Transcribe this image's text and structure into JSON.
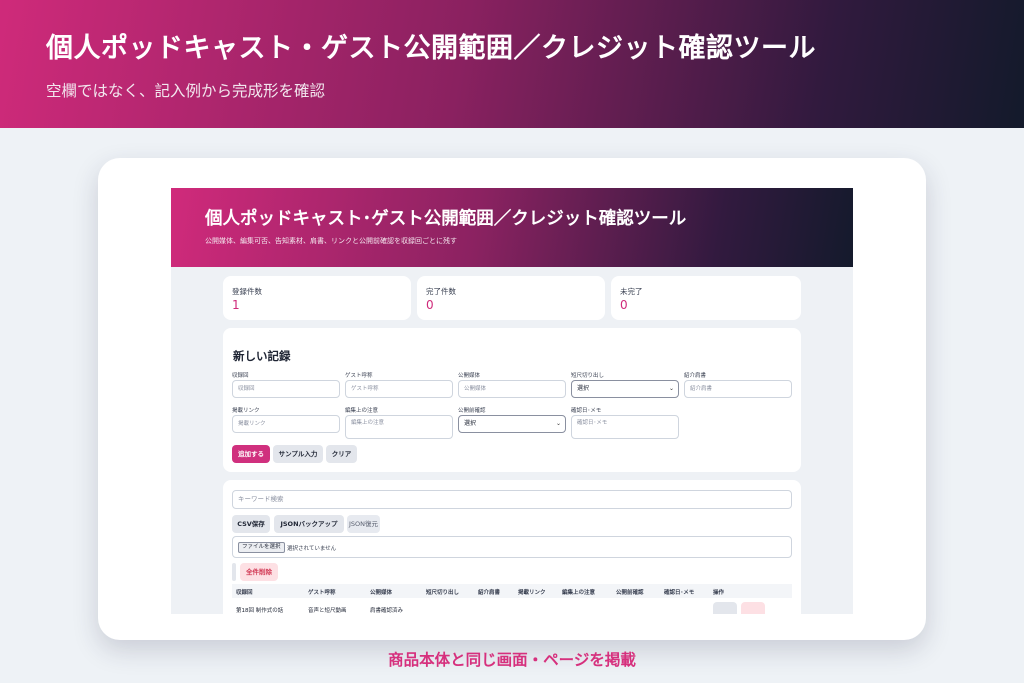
{
  "banner": {
    "title": "個人ポッドキャスト・ゲスト公開範囲／クレジット確認ツール",
    "subtitle": "空欄ではなく、記入例から完成形を確認"
  },
  "app": {
    "title": "個人ポッドキャスト･ゲスト公開範囲／クレジット確認ツール",
    "subtitle": "公開媒体、編集可否、告知素材、肩書、リンクと公開前確認を収録回ごとに残す",
    "stats": [
      {
        "label": "登録件数",
        "value": "1"
      },
      {
        "label": "完了件数",
        "value": "0"
      },
      {
        "label": "未完了",
        "value": "0"
      }
    ],
    "form": {
      "title": "新しい記録",
      "fields": [
        {
          "label": "収録回",
          "placeholder": "収録回"
        },
        {
          "label": "ゲスト呼称",
          "placeholder": "ゲスト呼称"
        },
        {
          "label": "公開媒体",
          "placeholder": "公開媒体"
        },
        {
          "label": "短尺切り出し",
          "value": "選択"
        },
        {
          "label": "紹介肩書",
          "placeholder": "紹介肩書"
        },
        {
          "label": "掲載リンク",
          "placeholder": "掲載リンク"
        },
        {
          "label": "編集上の注意",
          "placeholder": "編集上の注意"
        },
        {
          "label": "公開前確認",
          "value": "選択"
        },
        {
          "label": "確認日･メモ",
          "placeholder": "確認日･メモ"
        }
      ],
      "add_button": "追加する",
      "sample_button": "サンプル入力",
      "clear_button": "クリア"
    },
    "list": {
      "search_placeholder": "キーワード検索",
      "csv_button": "CSV保存",
      "json_backup_button": "JSONバックアップ",
      "json_restore_button": "JSON復元",
      "file_button": "ファイルを選択",
      "file_status": "選択されていません",
      "delete_all_button": "全件削除",
      "columns": [
        "収録回",
        "ゲスト呼称",
        "公開媒体",
        "短尺切り出し",
        "紹介肩書",
        "掲載リンク",
        "編集上の注意",
        "公開前確認",
        "確認日･メモ",
        "操作"
      ],
      "rows": [
        {
          "cells": [
            "第18回 制作式の話",
            "音声と短尺動画",
            "肩書確認済み"
          ]
        }
      ]
    }
  },
  "caption": "商品本体と同じ画面・ページを掲載",
  "colors": {
    "accent": "#d0307e",
    "header_dark": "#141a2c",
    "danger_bg": "#fde0e4"
  }
}
